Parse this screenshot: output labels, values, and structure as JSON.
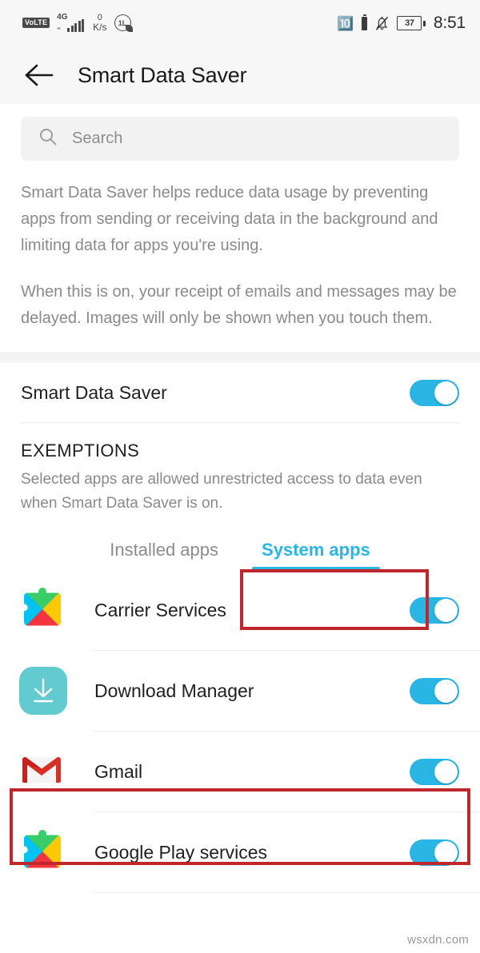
{
  "statusbar": {
    "volte_label": "VoLTE",
    "network_type": "4G",
    "net_speed_value": "0",
    "net_speed_unit": "K/s",
    "clock_icon_label": "1L",
    "battery_percent": "37",
    "time": "8:51",
    "icons": [
      "volte-badge",
      "signal-bars-icon",
      "network-speed-indicator",
      "data-limit-icon",
      "bluetooth-icon",
      "bluetooth-battery-icon",
      "notifications-off-icon",
      "battery-icon"
    ]
  },
  "appbar": {
    "back_icon": "back-arrow-icon",
    "title": "Smart Data Saver"
  },
  "search": {
    "icon": "search-icon",
    "placeholder": "Search",
    "value": ""
  },
  "description": {
    "paragraph_1": "Smart Data Saver helps reduce data usage by preventing apps from sending or receiving data in the background and limiting data for apps you're using.",
    "paragraph_2": "When this is on, your receipt of emails and messages may be delayed. Images will only be shown when you touch them."
  },
  "main_toggle": {
    "label": "Smart Data Saver",
    "state": "on"
  },
  "exemptions": {
    "heading": "EXEMPTIONS",
    "description": "Selected apps are allowed unrestricted access to data even when Smart Data Saver is on.",
    "tabs": [
      {
        "label": "Installed apps",
        "active": false
      },
      {
        "label": "System apps",
        "active": true
      }
    ]
  },
  "apps": [
    {
      "name": "Carrier Services",
      "icon": "google-play-services-puzzle-icon",
      "toggle": "on"
    },
    {
      "name": "Download Manager",
      "icon": "download-manager-icon",
      "toggle": "on"
    },
    {
      "name": "Gmail",
      "icon": "gmail-icon",
      "toggle": "on"
    },
    {
      "name": "Google Play services",
      "icon": "google-play-services-puzzle-icon",
      "toggle": "on"
    }
  ],
  "annotations": [
    {
      "name": "system-apps-tab-highlight",
      "color": "#c0272d"
    },
    {
      "name": "gmail-row-highlight",
      "color": "#c0272d"
    }
  ],
  "watermark": "wsxdn.com",
  "colors": {
    "accent": "#29b6e5",
    "annotation": "#c0272d",
    "statusbar_bg": "#f7f7f7",
    "body_text": "#8a8a8a"
  }
}
